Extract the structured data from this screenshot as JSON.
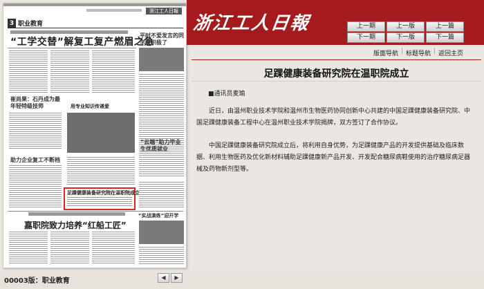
{
  "header": {
    "logo_text": "浙江工人日報",
    "nav": {
      "prev_issue": "上一期",
      "prev_page": "上一版",
      "prev_article": "上一篇",
      "next_issue": "下一期",
      "next_page": "下一版",
      "next_article": "下一篇"
    }
  },
  "subnav": {
    "items": [
      "版面导航",
      "标题导航",
      "返回主页"
    ],
    "separator": "|"
  },
  "article": {
    "title": "足踝健康装备研究院在温职院成立",
    "reporter": "■通讯员麦瑜",
    "paragraphs": [
      "近日，由温州职业技术学院和温州市生物医药协同创新中心共建的中国足踝健康装备研究院、中国足踝健康装备工程中心在温州职业技术学院揭牌，双方签订了合作协议。",
      "中国足踝健康装备研究院成立后，将利用自身优势，为足踝健康产品的开发提供基础及临床数据、利用生物医药及优化新材料辅助足踝健康新产品开发、开发配合糖尿病鞋使用的治疗糖尿病足器械及药物新剂型等。"
    ]
  },
  "newspaper_page": {
    "page_number": "3",
    "section_name": "职业教育",
    "masthead": "浙江工人日報",
    "main_headline": "“工学交替”解复工复产燃眉之急",
    "side_title": "平时不爱发言的同学变积极了",
    "sub_heads": [
      "崔尚果：石丹成为最年轻特级技师",
      "助力企业复工不断档",
      "用专业知识传递爱",
      "“云端”助力毕业生优质就业",
      "嘉职院致力培养“红船工匠”",
      "“实战演练”迎开学"
    ],
    "highlighted_article": "足踝健康装备研究院在温职院成立"
  },
  "footer": {
    "page_label": "00003版：职业教育",
    "prev_symbol": "◀",
    "next_symbol": "▶"
  },
  "colors": {
    "brand_red": "#a51a1d",
    "page_bg": "#eae7e2",
    "highlight_border": "#d9251d"
  }
}
